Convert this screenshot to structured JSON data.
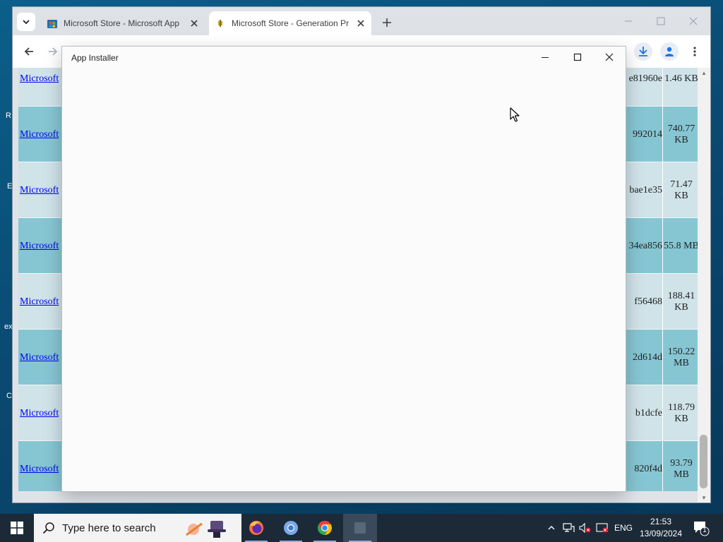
{
  "desktop": {
    "fragments": [
      "R",
      "E",
      "ex",
      "C"
    ]
  },
  "browser": {
    "tabs": [
      {
        "title": "Microsoft Store - Microsoft App",
        "favicon": "microsoft-store-icon"
      },
      {
        "title": "Microsoft Store - Generation Pr",
        "favicon": "generation-project-icon"
      }
    ],
    "rows": [
      {
        "name": "Microsoft",
        "hash": "e81960e",
        "size": "1.46 KB"
      },
      {
        "name": "Microsoft",
        "hash": "992014",
        "size": "740.77 KB"
      },
      {
        "name": "Microsoft",
        "hash": "bae1e35",
        "size": "71.47 KB"
      },
      {
        "name": "Microsoft",
        "hash": "34ea856",
        "size": "55.8 MB"
      },
      {
        "name": "Microsoft",
        "hash": "f56468",
        "size": "188.41 KB"
      },
      {
        "name": "Microsoft",
        "hash": "2d614d",
        "size": "150.22 MB"
      },
      {
        "name": "Microsoft",
        "hash": "b1dcfe",
        "size": "118.79 KB"
      },
      {
        "name": "Microsoft",
        "hash": "820f4d",
        "size": "93.79 MB"
      }
    ]
  },
  "dialog": {
    "title": "App Installer"
  },
  "taskbar": {
    "search_placeholder": "Type here to search",
    "language": "ENG",
    "time": "21:53",
    "date": "13/09/2024",
    "notification_count": "1"
  },
  "colors": {
    "row_dark": "#86c6d3",
    "row_light": "#cfe3e9",
    "link": "#0000ee",
    "taskbar": "#1c2a38"
  }
}
